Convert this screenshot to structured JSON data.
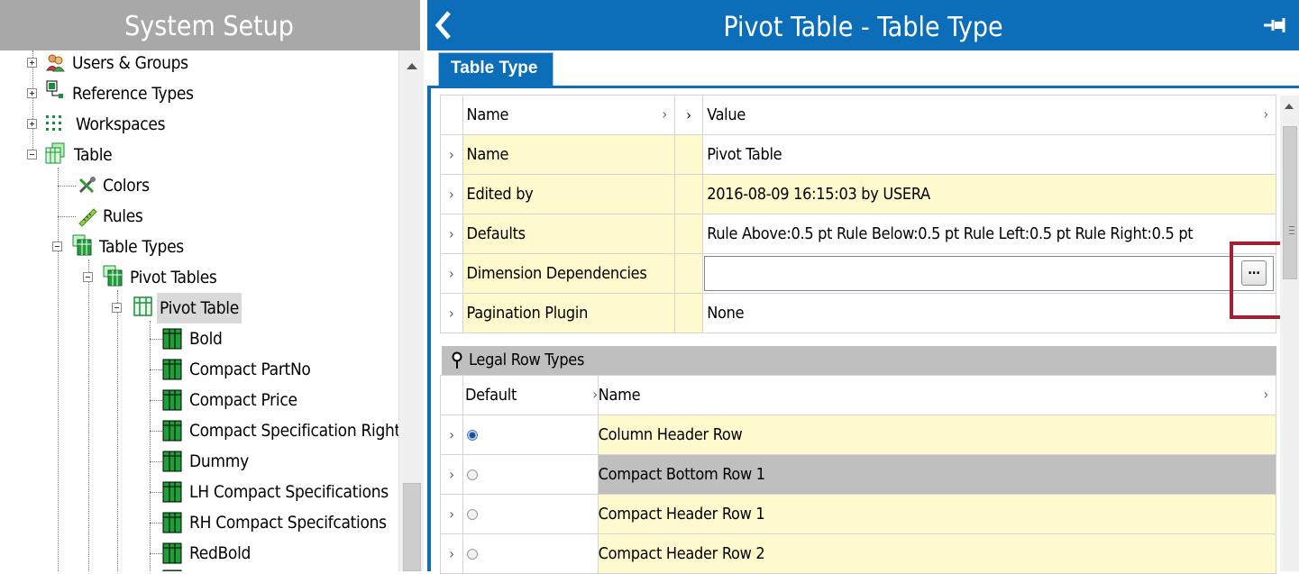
{
  "left_panel": {
    "title": "System Setup",
    "tree": [
      {
        "label": "Users & Groups",
        "icon": "users-groups-icon",
        "expander": "plus"
      },
      {
        "label": "Reference Types",
        "icon": "reference-types-icon",
        "expander": "plus"
      },
      {
        "label": "Workspaces",
        "icon": "workspaces-icon",
        "expander": "plus"
      },
      {
        "label": "Table",
        "icon": "table-icon",
        "expander": "minus"
      },
      {
        "label": "Colors",
        "icon": "colors-tools-icon"
      },
      {
        "label": "Rules",
        "icon": "ruler-icon"
      },
      {
        "label": "Table Types",
        "icon": "table-types-icon",
        "expander": "minus"
      },
      {
        "label": "Pivot Tables",
        "icon": "pivot-tables-icon",
        "expander": "minus"
      },
      {
        "label": "Pivot Table",
        "icon": "pivot-table-icon",
        "expander": "minus",
        "selected": true
      },
      {
        "label": "Bold",
        "icon": "table-style-icon"
      },
      {
        "label": "Compact PartNo",
        "icon": "table-style-icon"
      },
      {
        "label": "Compact Price",
        "icon": "table-style-icon"
      },
      {
        "label": "Compact Specification Right",
        "icon": "table-style-icon"
      },
      {
        "label": "Dummy",
        "icon": "table-style-icon"
      },
      {
        "label": "LH Compact Specifications",
        "icon": "table-style-icon"
      },
      {
        "label": "RH Compact Specifcations",
        "icon": "table-style-icon"
      },
      {
        "label": "RedBold",
        "icon": "table-style-icon"
      }
    ]
  },
  "right_panel": {
    "title": "Pivot Table - Table Type",
    "back_icon": "chevron-left-icon",
    "pin_icon": "pin-icon",
    "tab": "Table Type",
    "properties": {
      "col_name": "Name",
      "col_value": "Value",
      "rows": [
        {
          "name": "Name",
          "value": "Pivot Table"
        },
        {
          "name": "Edited by",
          "value": "2016-08-09 16:15:03 by USERA"
        },
        {
          "name": "Defaults",
          "value": "Rule Above:0.5 pt Rule Below:0.5 pt Rule Left:0.5 pt Rule Right:0.5 pt"
        },
        {
          "name": "Dimension Dependencies",
          "value": ""
        },
        {
          "name": "Pagination Plugin",
          "value": "None"
        }
      ],
      "ellipsis_button": "..."
    },
    "legal_row_types": {
      "title": "Legal Row Types",
      "col_default": "Default",
      "col_name": "Name",
      "rows": [
        {
          "name": "Column Header Row",
          "default": true
        },
        {
          "name": "Compact Bottom Row 1",
          "default": false,
          "highlight": "gray"
        },
        {
          "name": "Compact Header Row 1",
          "default": false
        },
        {
          "name": "Compact Header Row 2",
          "default": false
        }
      ]
    },
    "colors": {
      "accent": "#0c6eb8",
      "row_yellow": "#fffacd",
      "highlight_box": "#a32033",
      "left_header": "#a8a8a8"
    }
  }
}
